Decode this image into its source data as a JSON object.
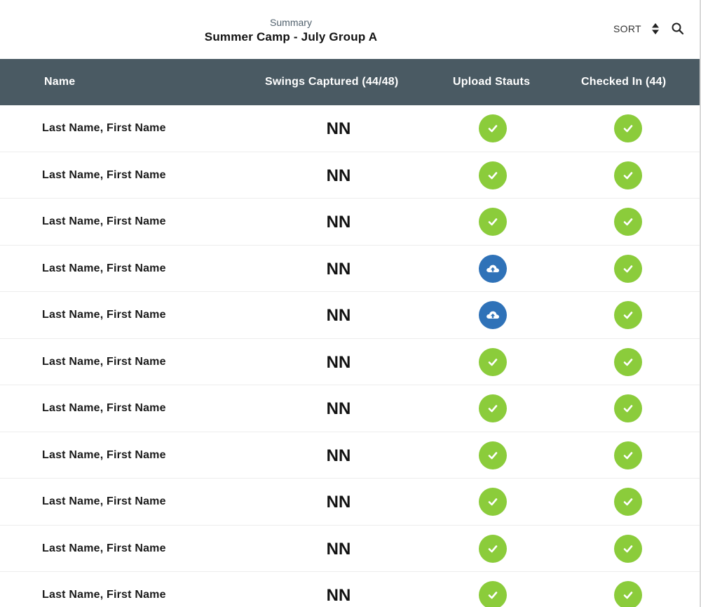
{
  "header": {
    "subtitle": "Summary",
    "title": "Summer Camp - July Group A",
    "sort_label": "SORT"
  },
  "table": {
    "columns": [
      "Name",
      "Swings Captured (44/48)",
      "Upload Stauts",
      "Checked In (44)"
    ],
    "rows": [
      {
        "name": "Last Name, First Name",
        "swings": "NN",
        "upload": "done",
        "checked_in": true
      },
      {
        "name": "Last Name, First Name",
        "swings": "NN",
        "upload": "done",
        "checked_in": true
      },
      {
        "name": "Last Name, First Name",
        "swings": "NN",
        "upload": "done",
        "checked_in": true
      },
      {
        "name": "Last Name, First Name",
        "swings": "NN",
        "upload": "pending",
        "checked_in": true
      },
      {
        "name": "Last Name, First Name",
        "swings": "NN",
        "upload": "pending",
        "checked_in": true
      },
      {
        "name": "Last Name, First Name",
        "swings": "NN",
        "upload": "done",
        "checked_in": true
      },
      {
        "name": "Last Name, First Name",
        "swings": "NN",
        "upload": "done",
        "checked_in": true
      },
      {
        "name": "Last Name, First Name",
        "swings": "NN",
        "upload": "done",
        "checked_in": true
      },
      {
        "name": "Last Name, First Name",
        "swings": "NN",
        "upload": "done",
        "checked_in": true
      },
      {
        "name": "Last Name, First Name",
        "swings": "NN",
        "upload": "done",
        "checked_in": true
      },
      {
        "name": "Last Name, First Name",
        "swings": "NN",
        "upload": "done",
        "checked_in": true
      }
    ]
  },
  "icons": {
    "sort": "sort-arrows-icon",
    "search": "search-icon",
    "done": "checkmark-circle-icon",
    "pending": "cloud-upload-icon"
  },
  "colors": {
    "header_bar": "#4a5a63",
    "done_green": "#8bcc3b",
    "upload_blue": "#2f72b8"
  }
}
